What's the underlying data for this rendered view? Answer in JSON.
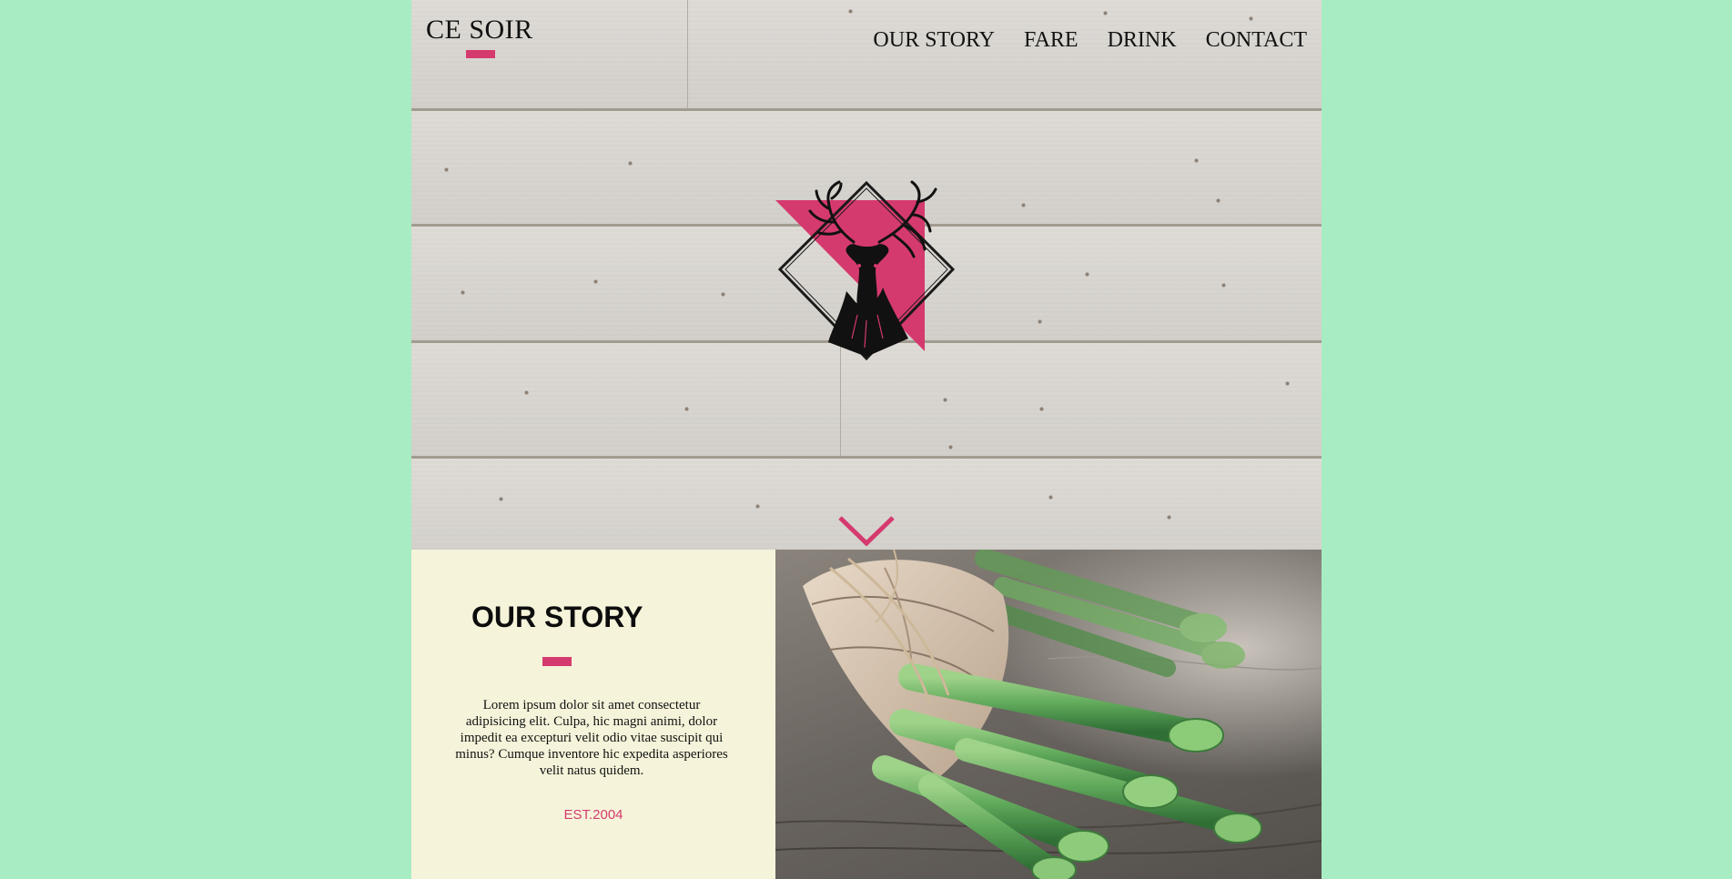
{
  "brand": {
    "name": "CE SOIR"
  },
  "nav": {
    "items": [
      {
        "label": "OUR STORY"
      },
      {
        "label": "FARE"
      },
      {
        "label": "DRINK"
      },
      {
        "label": "CONTACT"
      }
    ]
  },
  "hero": {
    "emblem_icon": "stag-head-emblem-icon",
    "scroll_icon": "chevron-down-icon"
  },
  "story": {
    "title": "OUR STORY",
    "body": "Lorem ipsum dolor sit amet consectetur adipisicing elit. Culpa, hic magni animi, dolor impedit ea excepturi velit odio vitae suscipit qui minus? Cumque inventore hic expedita asperiores velit natus quidem.",
    "established": "EST.2004"
  },
  "photo": {
    "icon": "asparagus-bundle-photo"
  },
  "colors": {
    "page_background": "#a8ecc3",
    "accent": "#d53a6e",
    "story_background": "#f5f4da"
  }
}
